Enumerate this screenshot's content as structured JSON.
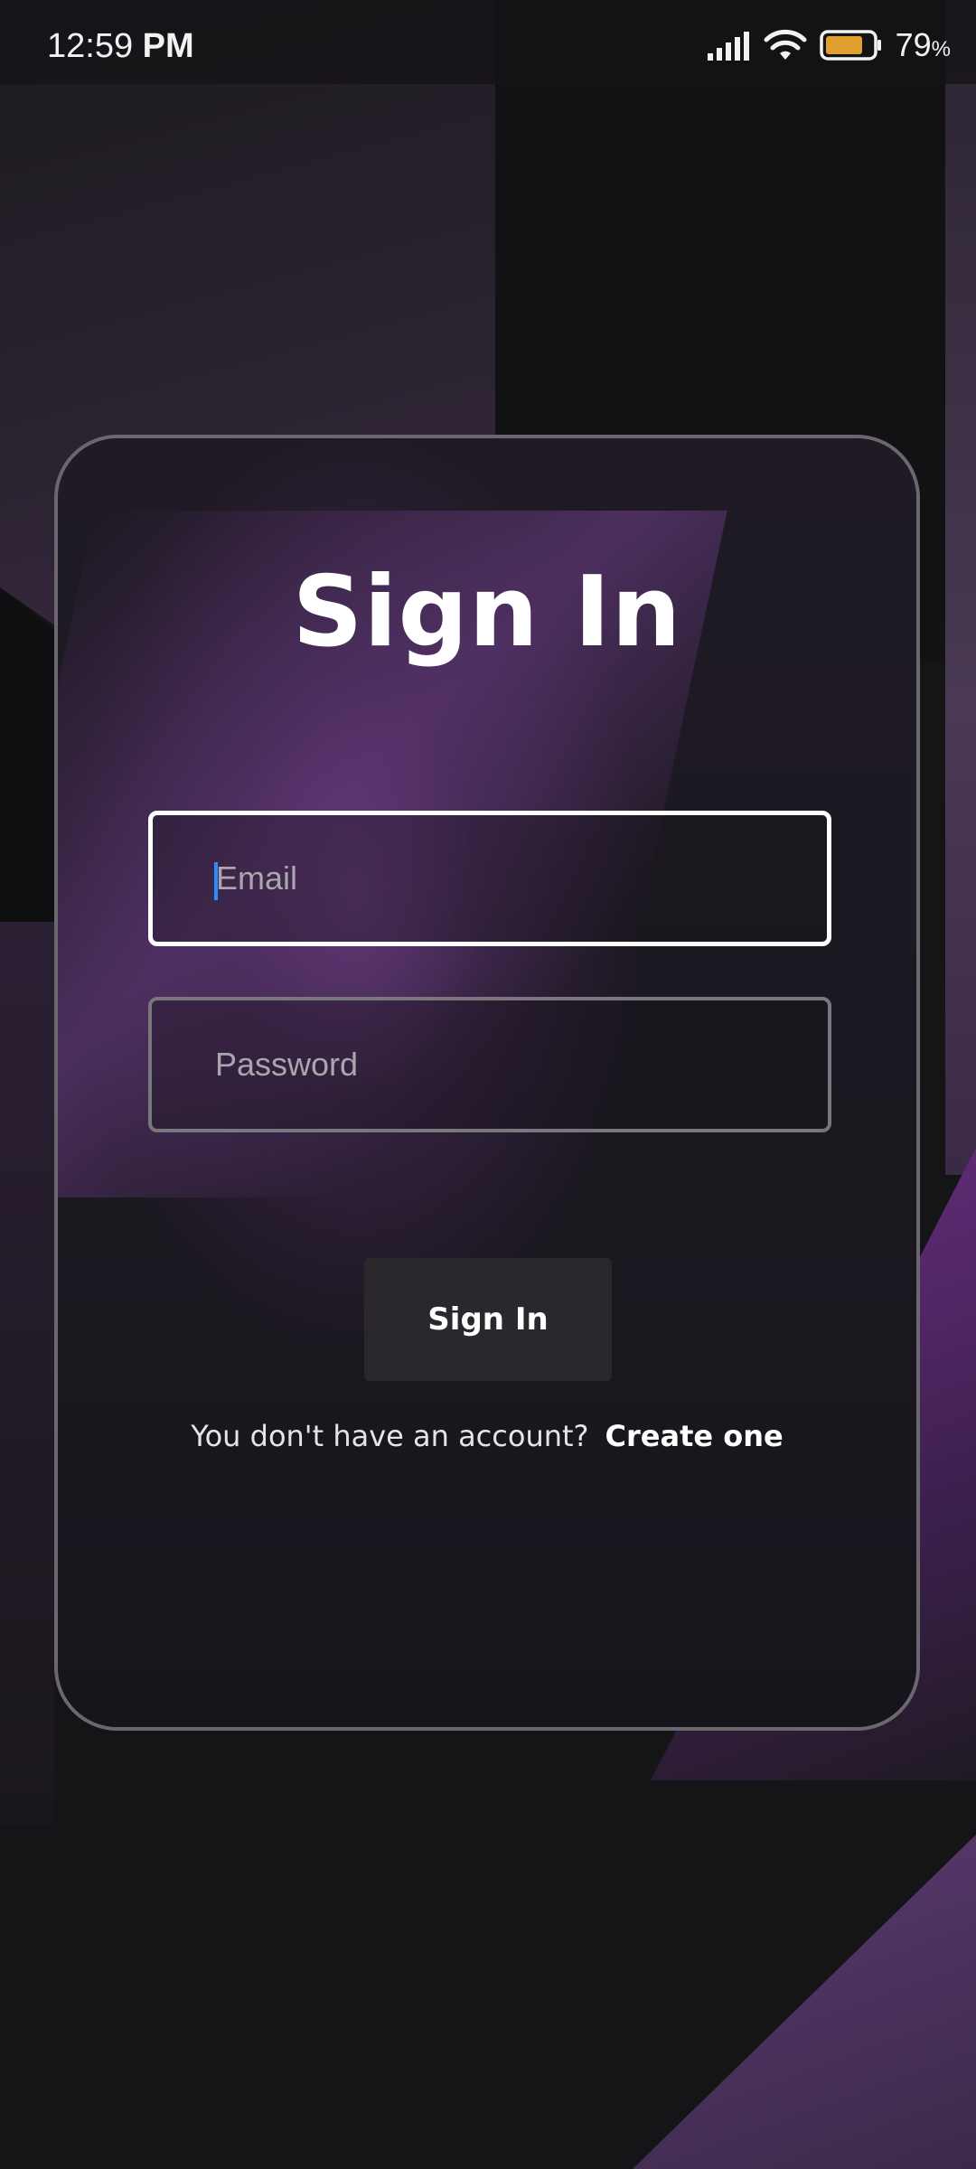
{
  "status_bar": {
    "time": "12:59",
    "meridiem": "PM",
    "battery_percent": "79",
    "battery_suffix": "%",
    "battery_level": 0.79,
    "battery_color": "#e0a030",
    "icons": [
      "signal-icon",
      "wifi-icon",
      "battery-icon"
    ]
  },
  "signin": {
    "title": "Sign In",
    "email_placeholder": "Email",
    "password_placeholder": "Password",
    "button_label": "Sign In",
    "no_account_text": "You don't have an account?",
    "create_link": "Create one"
  },
  "colors": {
    "accent_purple": "#6a2f80",
    "cursor": "#2f8bff",
    "card_border": "#6b676f"
  }
}
